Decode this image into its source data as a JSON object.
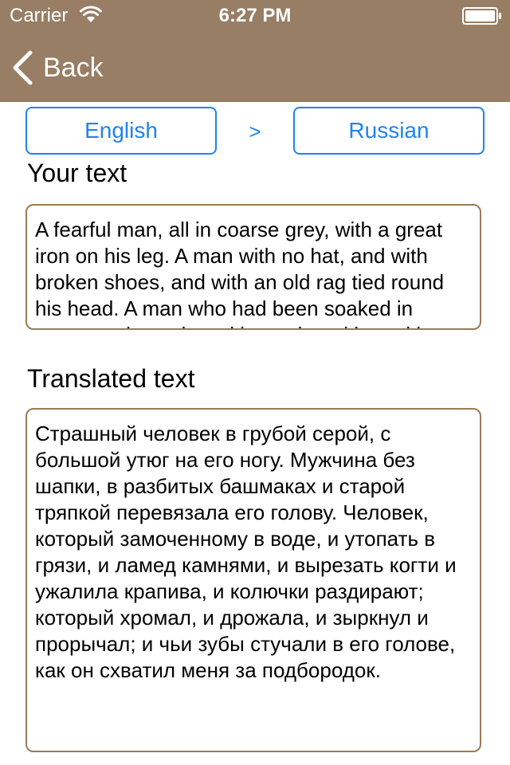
{
  "status_bar": {
    "carrier": "Carrier",
    "time": "6:27 PM",
    "wifi_icon": "wifi-icon",
    "battery_icon": "battery-full-icon"
  },
  "nav": {
    "back_label": "Back",
    "back_icon": "chevron-left-icon",
    "background_color": "#977e64"
  },
  "languages": {
    "from": "English",
    "separator": ">",
    "to": "Russian",
    "accent_color": "#1e83f0"
  },
  "source": {
    "label": "Your text",
    "text": "A fearful man, all in coarse grey, with a great iron on his leg. A man with no hat, and with broken shoes, and with an old rag tied round his head. A man who had been soaked in water, and smothered in mud, and lamed by stones, and cut by flints, and stung by nettles, and torn by briars; who limped, and shivered, and glared and growled; and whose teeth chattered in his head as he seized me by the chin."
  },
  "translation": {
    "label": "Translated text",
    "text": "Страшный человек в грубой серой, с большой утюг на его ногу. Мужчина без шапки, в разбитых башмаках и старой тряпкой перевязала его голову. Человек, который замоченному в воде, и утопать в грязи, и ламед камнями, и вырезать когти и ужалила крапива, и колючки раздирают; который хромал, и дрожала, и зыркнул и прорычал; и чьи зубы стучали в его голове, как он схватил меня за подбородок."
  },
  "border_color": "#9a7a55"
}
